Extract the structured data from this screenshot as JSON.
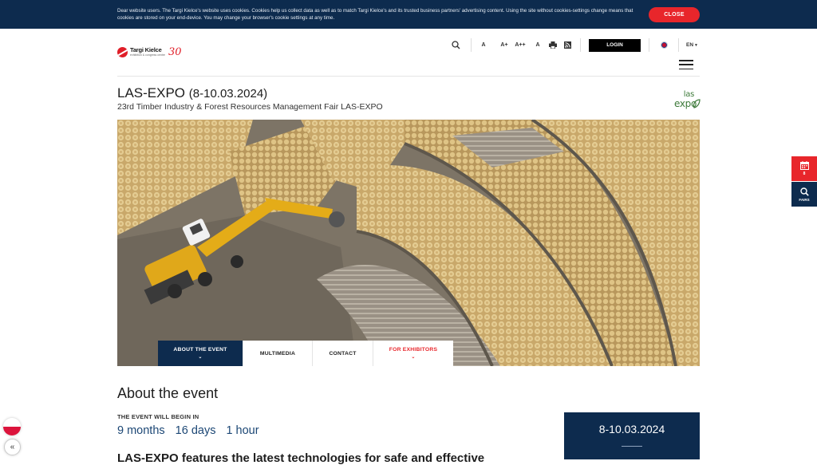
{
  "cookie": {
    "text": "Dear website users. The Targi Kielce's website uses cookies. Cookies help us collect data as well as to match Targi Kielce's and its trusted business partners' advertising content. Using the site without cookies-settings change means that cookies are stored on your end-device. You may change your browser's cookie settings at any time.",
    "close_label": "CLOSE"
  },
  "logo": {
    "name": "Targi Kielce",
    "sub": "exhibition & congress centre",
    "anniversary": "30"
  },
  "toolbar": {
    "font_a": "A",
    "font_a_plus": "A+",
    "font_a_plus_plus": "A++",
    "contrast": "A",
    "login_label": "LOGIN",
    "language": "EN"
  },
  "event": {
    "name": "LAS-EXPO",
    "dates": "(8-10.03.2024)",
    "subtitle": "23rd Timber Industry & Forest Resources Management Fair LAS-EXPO",
    "logo_top": "las",
    "logo_bottom": "expo"
  },
  "tabs": [
    {
      "label": "ABOUT THE EVENT"
    },
    {
      "label": "MULTIMEDIA"
    },
    {
      "label": "CONTACT"
    },
    {
      "label": "FOR EXHIBITORS"
    }
  ],
  "side": {
    "calendar_num": "8",
    "fairs_label": "FAIRS"
  },
  "about": {
    "heading": "About the event",
    "begin_label": "THE EVENT WILL BEGIN IN",
    "months": "9 months",
    "days": "16 days",
    "hours": "1 hour",
    "lead": "LAS-EXPO features the latest technologies for safe and effective",
    "date_box": "8-10.03.2024"
  },
  "colors": {
    "navy": "#0d2b4e",
    "red": "#e8262b",
    "link_blue": "#1c4775"
  }
}
